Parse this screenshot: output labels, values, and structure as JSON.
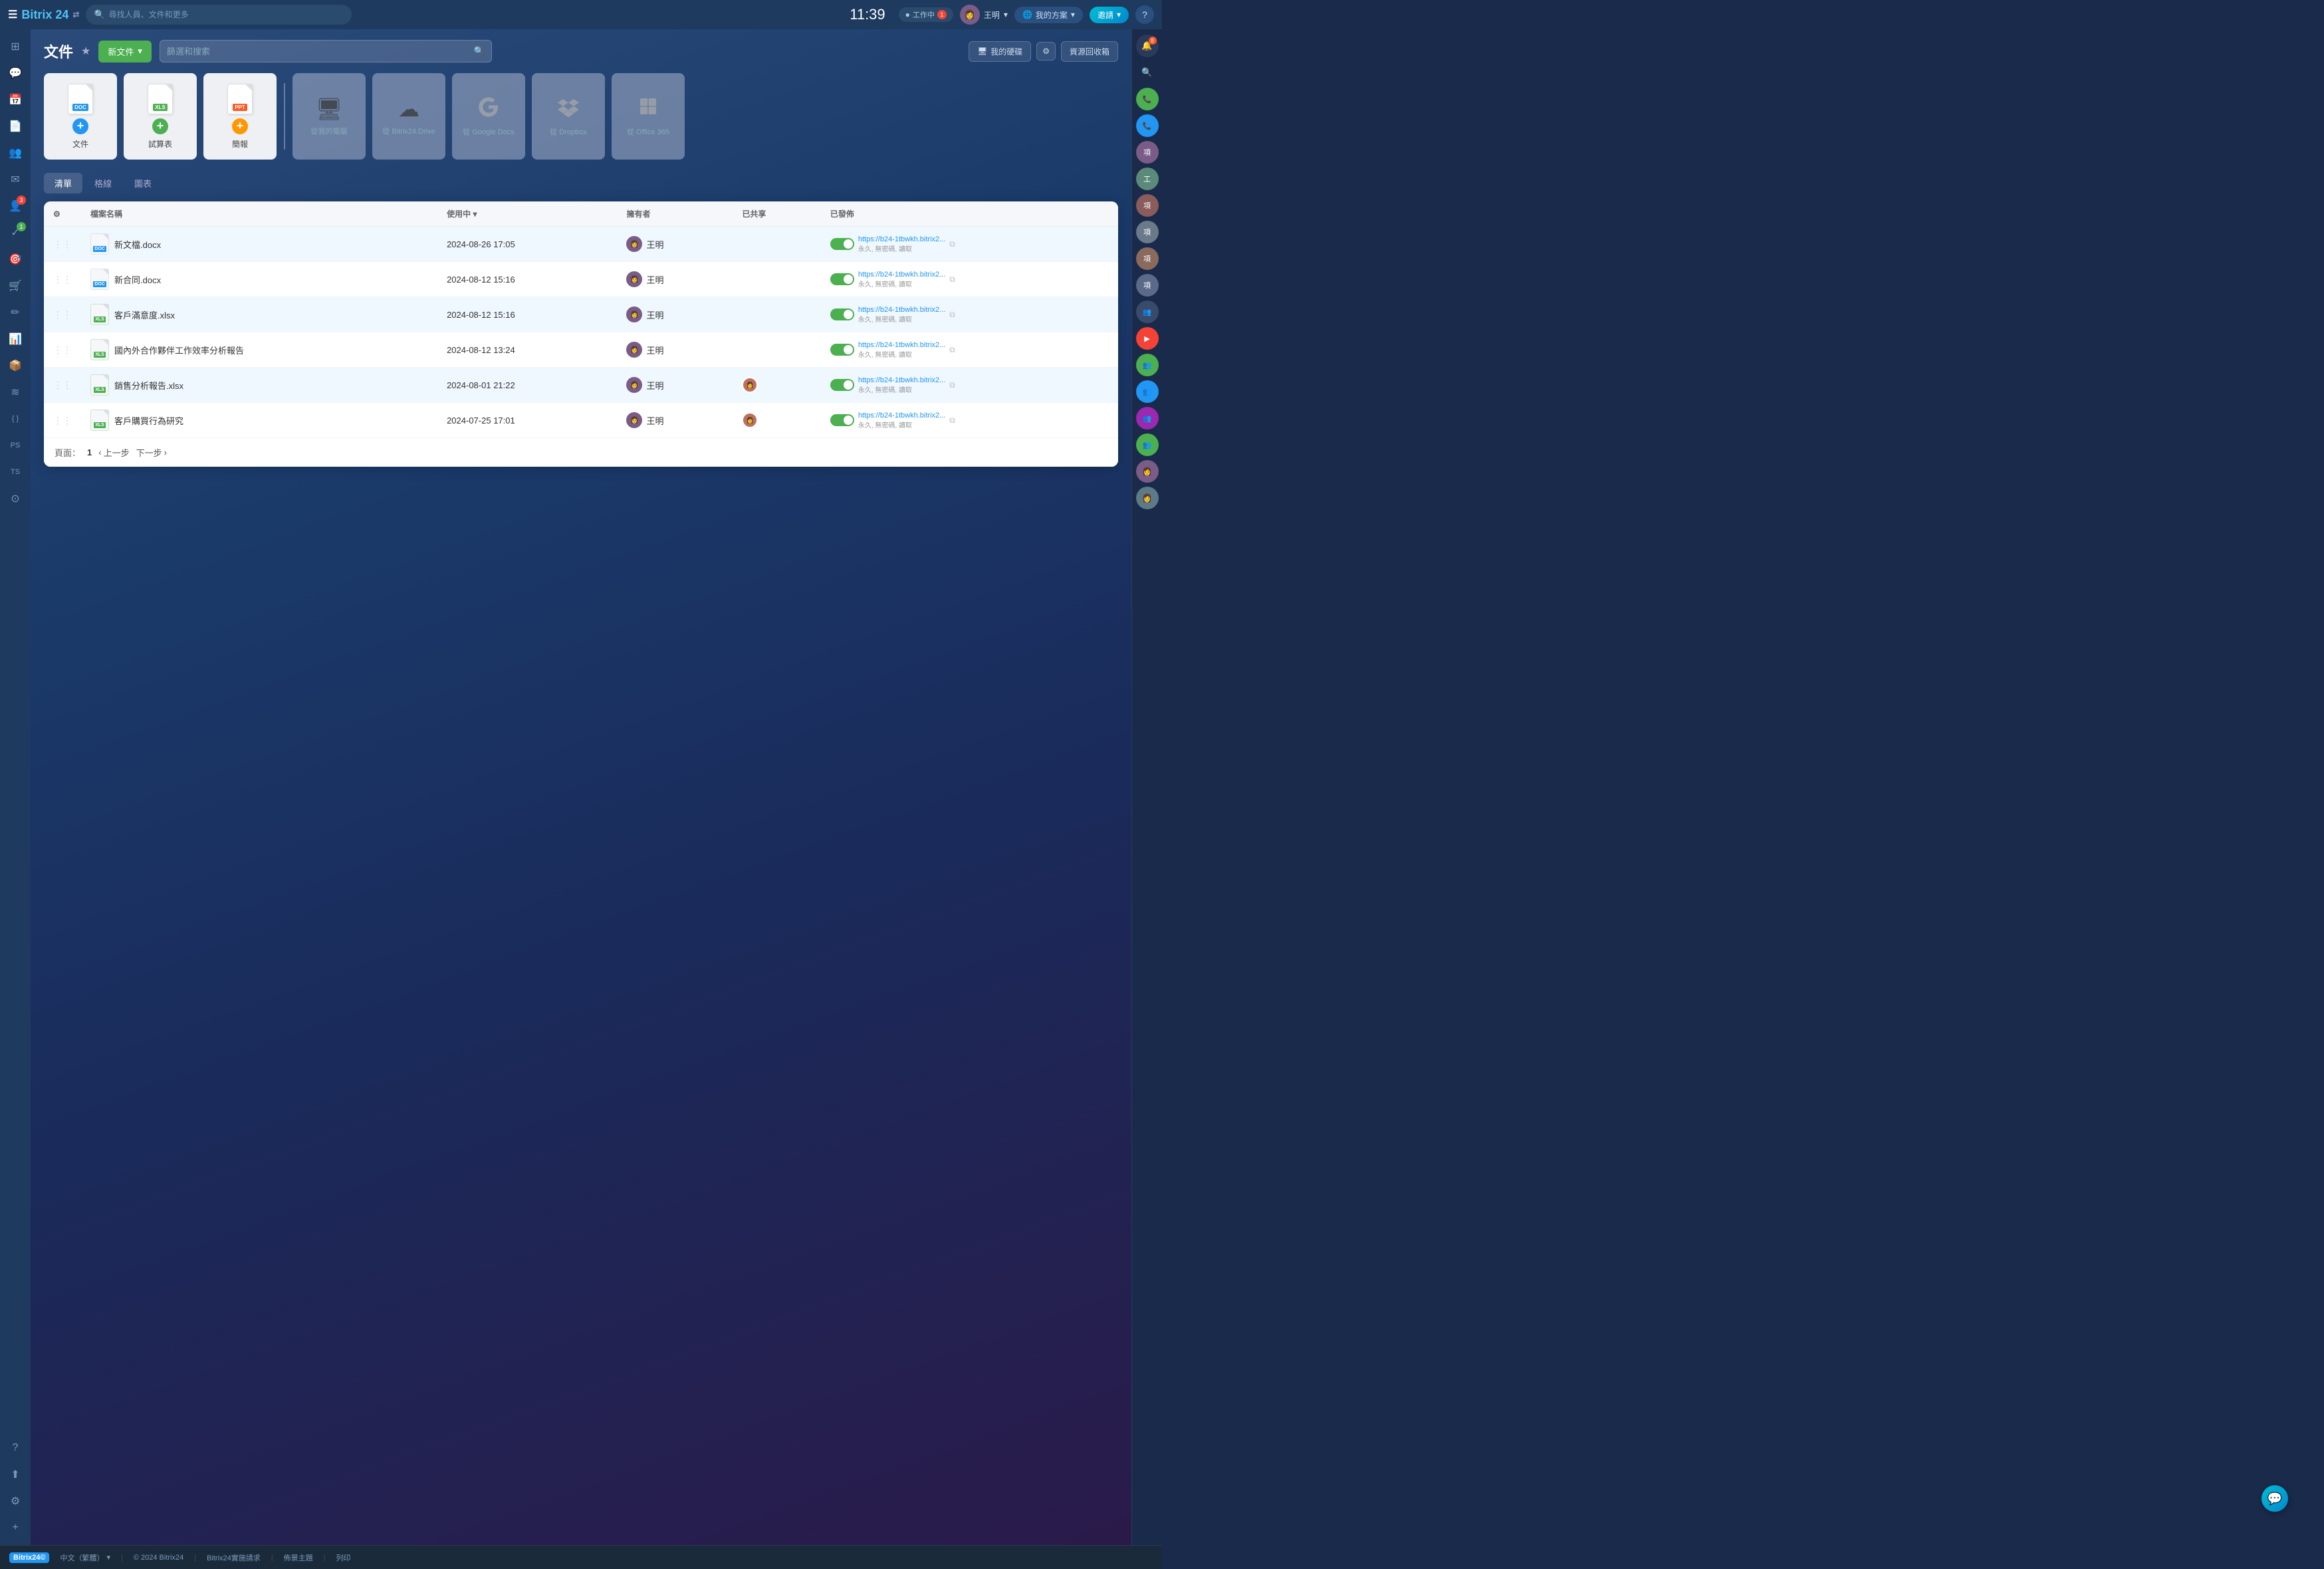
{
  "app": {
    "name": "Bitrix 24",
    "time": "11:39"
  },
  "topbar": {
    "search_placeholder": "尋找人員、文件和更多",
    "status_label": "工作中",
    "status_count": "1",
    "user_name": "王明",
    "plan_label": "我的方案",
    "invite_label": "邀請"
  },
  "page": {
    "title": "文件",
    "new_file_label": "新文件",
    "search_placeholder": "篩選和搜索",
    "my_drive_label": "我的硬碟",
    "trash_label": "資源回收箱"
  },
  "upload_cards": [
    {
      "id": "doc",
      "label": "文件",
      "type": "doc",
      "plus_color": "blue"
    },
    {
      "id": "xls",
      "label": "試算表",
      "type": "xls",
      "plus_color": "green"
    },
    {
      "id": "ppt",
      "label": "簡報",
      "type": "ppt",
      "plus_color": "orange"
    },
    {
      "id": "computer",
      "label": "從我的電腦",
      "type": "computer"
    },
    {
      "id": "bitrix_drive",
      "label": "從 Bitrix24.Drive",
      "type": "cloud"
    },
    {
      "id": "google_docs",
      "label": "從 Google Docs",
      "type": "google"
    },
    {
      "id": "dropbox",
      "label": "從 Dropbox",
      "type": "dropbox"
    },
    {
      "id": "office365",
      "label": "從 Office 365",
      "type": "office"
    }
  ],
  "tabs": [
    {
      "id": "list",
      "label": "清單",
      "active": true
    },
    {
      "id": "grid",
      "label": "格線",
      "active": false
    },
    {
      "id": "chart",
      "label": "圖表",
      "active": false
    }
  ],
  "table": {
    "headers": {
      "name": "檔案名稱",
      "used_in": "使用中",
      "owner": "擁有者",
      "shared": "已共享",
      "published": "已發佈"
    },
    "rows": [
      {
        "id": 1,
        "name": "新文檔.docx",
        "type": "doc",
        "date": "2024-08-26 17:05",
        "owner": "王明",
        "shared": false,
        "published": true,
        "link": "https://b24-1tbwkh.bitrix2...",
        "link_sub": "永久, 無密碼, 讀取",
        "highlighted": true
      },
      {
        "id": 2,
        "name": "新合同.docx",
        "type": "doc",
        "date": "2024-08-12 15:16",
        "owner": "王明",
        "shared": false,
        "published": true,
        "link": "https://b24-1tbwkh.bitrix2...",
        "link_sub": "永久, 無密碼, 讀取",
        "highlighted": false
      },
      {
        "id": 3,
        "name": "客戶滿意度.xlsx",
        "type": "xls",
        "date": "2024-08-12 15:16",
        "owner": "王明",
        "shared": false,
        "published": true,
        "link": "https://b24-1tbwkh.bitrix2...",
        "link_sub": "永久, 無密碼, 讀取",
        "highlighted": true
      },
      {
        "id": 4,
        "name": "國內外合作夥伴工作效率分析報告",
        "type": "xls",
        "date": "2024-08-12 13:24",
        "owner": "王明",
        "shared": false,
        "published": true,
        "link": "https://b24-1tbwkh.bitrix2...",
        "link_sub": "永久, 無密碼, 讀取",
        "highlighted": false
      },
      {
        "id": 5,
        "name": "銷售分析報告.xlsx",
        "type": "xls",
        "date": "2024-08-01 21:22",
        "owner": "王明",
        "shared": true,
        "published": true,
        "link": "https://b24-1tbwkh.bitrix2...",
        "link_sub": "永久, 無密碼, 讀取",
        "highlighted": true
      },
      {
        "id": 6,
        "name": "客戶購買行為研究",
        "type": "xls",
        "date": "2024-07-25 17:01",
        "owner": "王明",
        "shared": true,
        "published": true,
        "link": "https://b24-1tbwkh.bitrix2...",
        "link_sub": "永久, 無密碼, 讀取",
        "highlighted": false
      }
    ]
  },
  "pagination": {
    "page_label": "頁面：",
    "current_page": "1",
    "prev_label": "上一步",
    "next_label": "下一步"
  },
  "footer": {
    "logo": "Bitrix24©",
    "lang": "中文（繁體）",
    "copyright": "© 2024 Bitrix24",
    "link1": "Bitrix24實施請求",
    "link2": "佈景主題",
    "link3": "列印"
  },
  "sidebar": {
    "left_items": [
      {
        "icon": "☰",
        "name": "menu",
        "badge": null
      },
      {
        "icon": "⊞",
        "name": "dashboard",
        "badge": null
      },
      {
        "icon": "💬",
        "name": "chat",
        "badge": null
      },
      {
        "icon": "📅",
        "name": "calendar",
        "badge": null
      },
      {
        "icon": "📄",
        "name": "documents",
        "badge": null
      },
      {
        "icon": "👥",
        "name": "contacts",
        "badge": null
      },
      {
        "icon": "✉",
        "name": "mail",
        "badge": null
      },
      {
        "icon": "👤",
        "name": "users",
        "badge": "3"
      },
      {
        "icon": "✓",
        "name": "tasks",
        "badge": "1"
      },
      {
        "icon": "🎯",
        "name": "goals",
        "badge": null
      },
      {
        "icon": "🛒",
        "name": "shop",
        "badge": null
      },
      {
        "icon": "✏",
        "name": "edit",
        "badge": null
      },
      {
        "icon": "📊",
        "name": "analytics",
        "badge": null
      },
      {
        "icon": "📦",
        "name": "storage",
        "badge": null
      },
      {
        "icon": "≋",
        "name": "automation",
        "badge": null
      },
      {
        "icon": "{ }",
        "name": "code",
        "badge": null
      },
      {
        "icon": "PS",
        "name": "ps",
        "badge": null
      },
      {
        "icon": "TS",
        "name": "ts",
        "badge": null
      },
      {
        "icon": "⊙",
        "name": "apps",
        "badge": null
      },
      {
        "icon": "?",
        "name": "help",
        "badge": null
      },
      {
        "icon": "⬆",
        "name": "sync",
        "badge": null
      },
      {
        "icon": "⚙",
        "name": "settings",
        "badge": null
      },
      {
        "icon": "+",
        "name": "add",
        "badge": null
      }
    ]
  },
  "colors": {
    "primary": "#2196f3",
    "success": "#4caf50",
    "warning": "#ff9800",
    "danger": "#f44336",
    "doc_blue": "#2196f3",
    "xls_green": "#4caf50",
    "ppt_orange": "#ff5722"
  }
}
